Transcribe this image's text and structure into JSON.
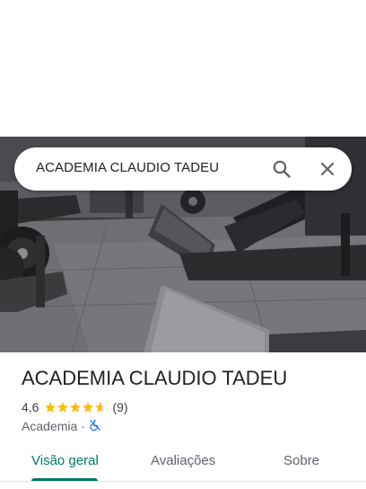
{
  "search": {
    "query": "ACADEMIA CLAUDIO TADEU",
    "search_icon": "search-icon",
    "close_icon": "close-icon"
  },
  "photo": {
    "subject": "gym interior with leg press machines"
  },
  "place": {
    "name": "ACADEMIA CLAUDIO TADEU",
    "rating": "4,6",
    "rating_value": 4.6,
    "review_count": "(9)",
    "category": "Academia",
    "separator": "·",
    "accessibility_icon": "no-wheelchair-access-icon"
  },
  "tabs": [
    {
      "label": "Visão geral",
      "active": true
    },
    {
      "label": "Avaliações",
      "active": false
    },
    {
      "label": "Sobre",
      "active": false
    }
  ],
  "colors": {
    "accent": "#00796b",
    "star": "#fbbc04",
    "accessibility": "#1a73e8"
  }
}
